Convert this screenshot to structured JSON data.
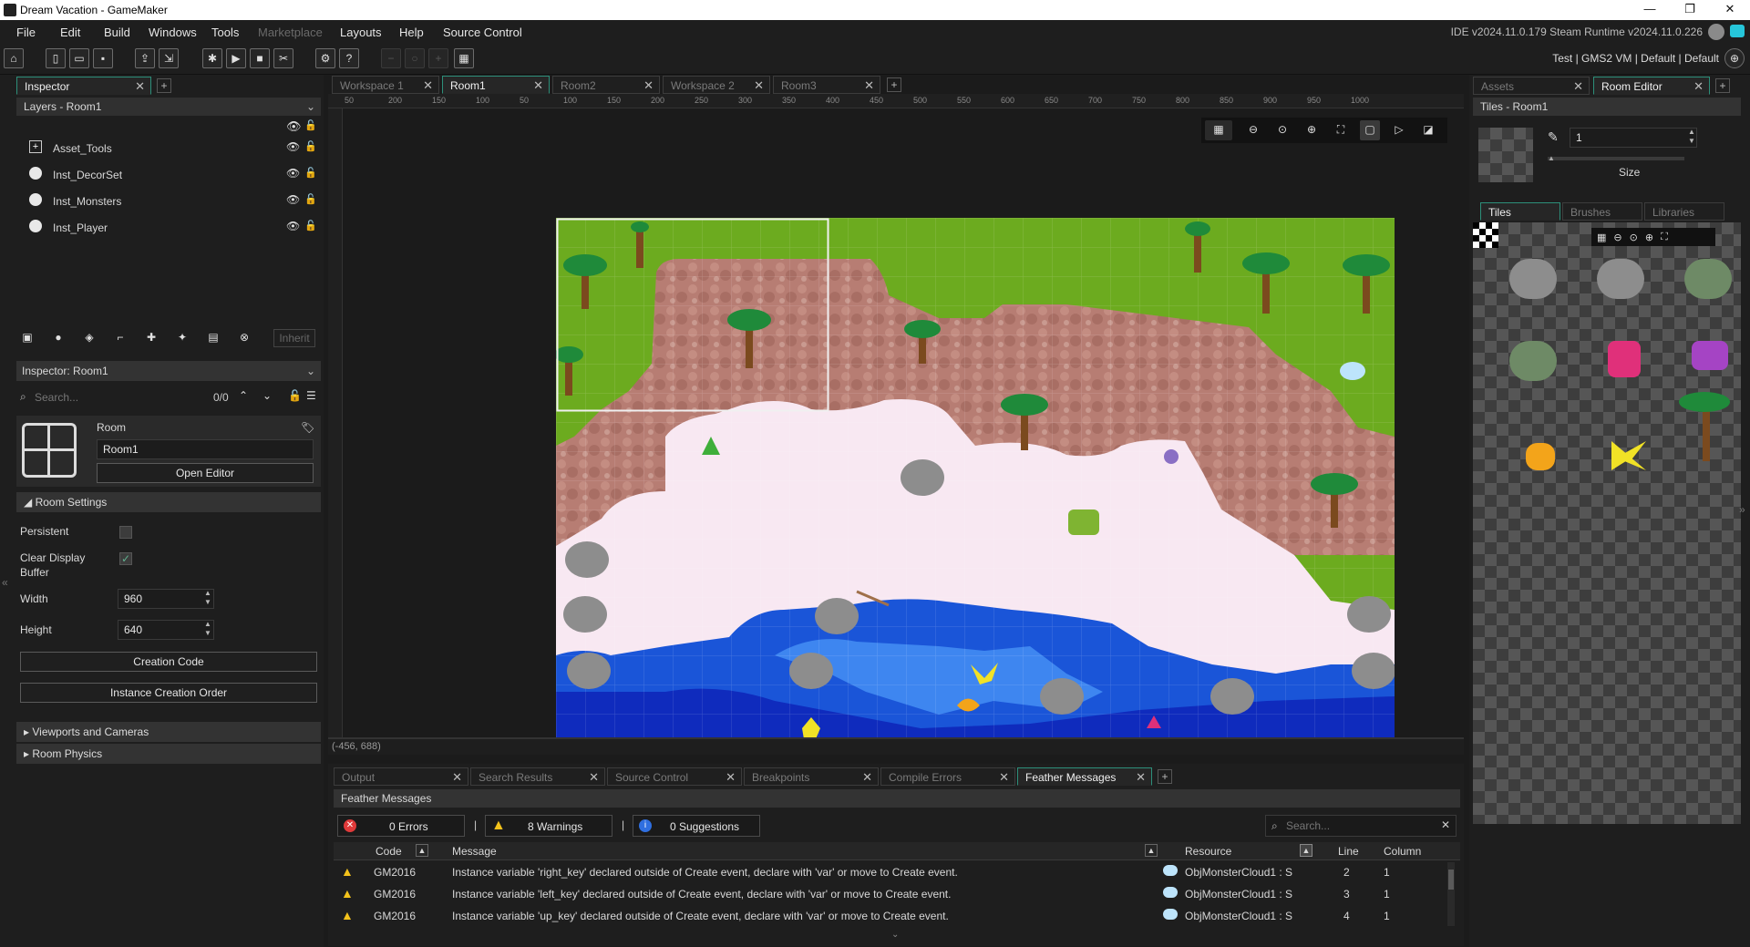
{
  "window": {
    "title": "Dream Vacation - GameMaker",
    "minimize": "—",
    "maximize": "❐",
    "close": "✕"
  },
  "menu": {
    "items": [
      "File",
      "Edit",
      "Build",
      "Windows",
      "Tools",
      "Marketplace",
      "Layouts",
      "Help",
      "Source Control"
    ],
    "disabled": [
      "Marketplace"
    ],
    "ide_version": "IDE v2024.11.0.179 Steam  Runtime v2024.11.0.226"
  },
  "toolbar": {
    "targets": "Test  |  GMS2 VM  |  Default  |  Default"
  },
  "left": {
    "tab": "Inspector",
    "layers_title": "Layers - Room1",
    "layers": [
      {
        "name": "Asset_Tools",
        "icon": "asset-layer-icon"
      },
      {
        "name": "Inst_DecorSet",
        "icon": "instance-layer-icon"
      },
      {
        "name": "Inst_Monsters",
        "icon": "instance-layer-icon"
      },
      {
        "name": "Inst_Player",
        "icon": "instance-layer-icon"
      }
    ],
    "inherit_label": "Inherit",
    "inspector_title": "Inspector: Room1",
    "search_placeholder": "Search...",
    "search_count": "0/0",
    "room_label": "Room",
    "room_name": "Room1",
    "open_editor": "Open Editor",
    "room_settings": "Room Settings",
    "persistent_label": "Persistent",
    "clear_display_label": "Clear Display Buffer",
    "width_label": "Width",
    "width_value": "960",
    "height_label": "Height",
    "height_value": "640",
    "creation_code": "Creation Code",
    "instance_creation_order": "Instance Creation Order",
    "viewports": "Viewports and Cameras",
    "room_physics": "Room Physics"
  },
  "center": {
    "tabs": [
      {
        "label": "Workspace 1",
        "active": false
      },
      {
        "label": "Room1",
        "active": true
      },
      {
        "label": "Room2",
        "active": false
      },
      {
        "label": "Workspace 2",
        "active": false
      },
      {
        "label": "Room3",
        "active": false
      }
    ],
    "ruler_labels": [
      "50",
      "200",
      "150",
      "100",
      "50",
      "100",
      "150",
      "200",
      "250",
      "300",
      "350",
      "400",
      "450",
      "500",
      "550",
      "600",
      "650",
      "700",
      "750",
      "800",
      "850",
      "900",
      "950",
      "1000"
    ],
    "coords": "(-456, 688)"
  },
  "right": {
    "tabs": [
      "Assets",
      "Room Editor"
    ],
    "tiles_title": "Tiles - Room1",
    "brush_size": "1",
    "size_label": "Size",
    "subtabs": [
      "Tiles",
      "Brushes",
      "Libraries"
    ]
  },
  "bottom": {
    "tabs": [
      "Output",
      "Search Results",
      "Source Control",
      "Breakpoints",
      "Compile Errors",
      "Feather Messages"
    ],
    "active_tab": "Feather Messages",
    "title": "Feather Messages",
    "errors": "0 Errors",
    "warnings": "8 Warnings",
    "suggestions": "0 Suggestions",
    "search_placeholder": "Search...",
    "columns": {
      "code": "Code",
      "message": "Message",
      "resource": "Resource",
      "line": "Line",
      "column": "Column"
    },
    "rows": [
      {
        "code": "GM2016",
        "message": "Instance variable 'right_key' declared outside of Create event, declare with 'var' or move to Create event.",
        "resource": "ObjMonsterCloud1 : S",
        "line": "2",
        "column": "1"
      },
      {
        "code": "GM2016",
        "message": "Instance variable 'left_key' declared outside of Create event, declare with 'var' or move to Create event.",
        "resource": "ObjMonsterCloud1 : S",
        "line": "3",
        "column": "1"
      },
      {
        "code": "GM2016",
        "message": "Instance variable 'up_key' declared outside of Create event, declare with 'var' or move to Create event.",
        "resource": "ObjMonsterCloud1 : S",
        "line": "4",
        "column": "1"
      }
    ]
  },
  "colors": {
    "accent": "#2d8f7a",
    "grass": "#6cab1f",
    "sand": "#f7e8f2",
    "water": "#1a55d8",
    "deep_water": "#0a1f8f",
    "rock_path": "#b97c72"
  }
}
